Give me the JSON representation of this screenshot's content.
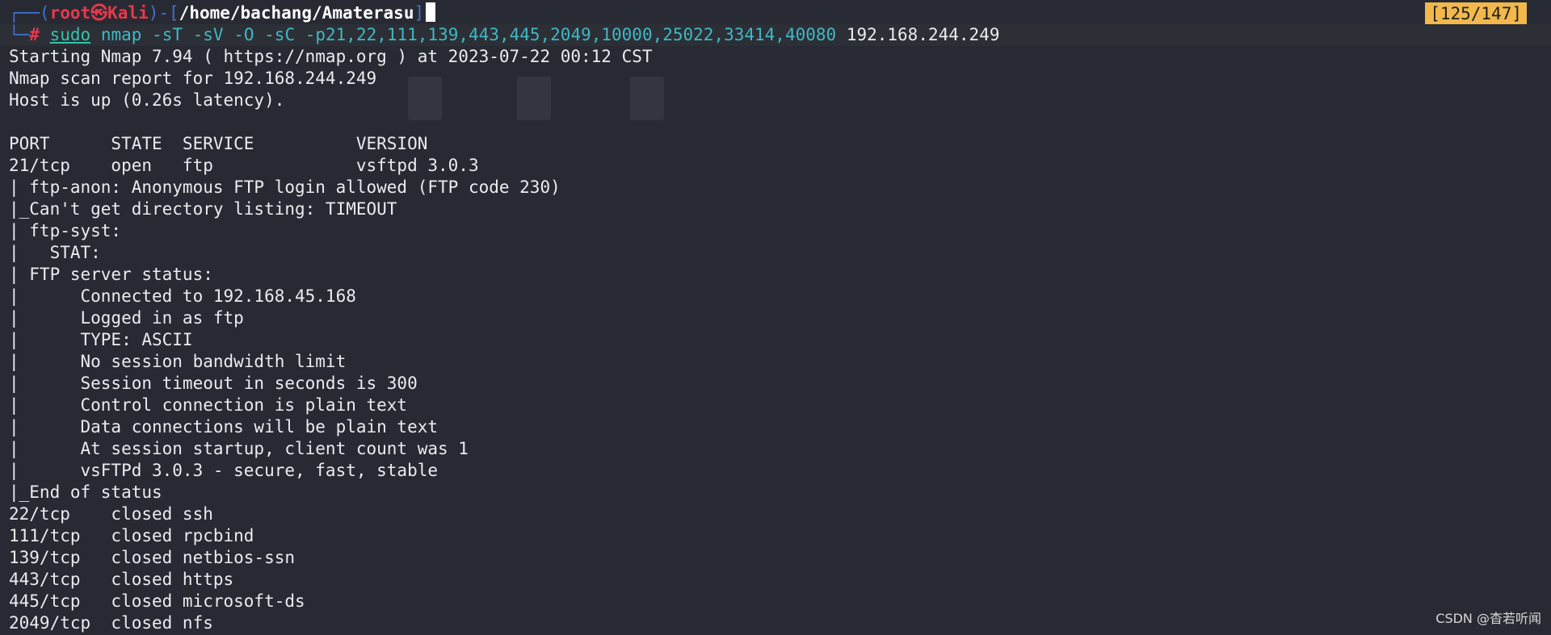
{
  "prompt": {
    "box_open": "┌──(",
    "user": "root",
    "skull": "㉿",
    "host": "Kali",
    "box_mid": ")-[",
    "path": "/home/bachang/Amaterasu",
    "box_close": "]",
    "box_bottom": "└─",
    "hash": "#"
  },
  "command": {
    "sudo": "sudo",
    "program": "nmap",
    "args": "-sT -sV -O -sC -p21,22,111,139,443,445,2049,10000,25022,33414,40080",
    "target": "192.168.244.249"
  },
  "history_counter": "[125/147]",
  "output_lines": [
    "Starting Nmap 7.94 ( https://nmap.org ) at 2023-07-22 00:12 CST",
    "Nmap scan report for 192.168.244.249",
    "Host is up (0.26s latency).",
    "",
    "PORT      STATE  SERVICE          VERSION",
    "21/tcp    open   ftp              vsftpd 3.0.3",
    "| ftp-anon: Anonymous FTP login allowed (FTP code 230)",
    "|_Can't get directory listing: TIMEOUT",
    "| ftp-syst: ",
    "|   STAT: ",
    "| FTP server status:",
    "|      Connected to 192.168.45.168",
    "|      Logged in as ftp",
    "|      TYPE: ASCII",
    "|      No session bandwidth limit",
    "|      Session timeout in seconds is 300",
    "|      Control connection is plain text",
    "|      Data connections will be plain text",
    "|      At session startup, client count was 1",
    "|      vsFTPd 3.0.3 - secure, fast, stable",
    "|_End of status",
    "22/tcp    closed ssh",
    "111/tcp   closed rpcbind",
    "139/tcp   closed netbios-ssn",
    "443/tcp   closed https",
    "445/tcp   closed microsoft-ds",
    "2049/tcp  closed nfs"
  ],
  "watermark": "CSDN @杳若听闻"
}
